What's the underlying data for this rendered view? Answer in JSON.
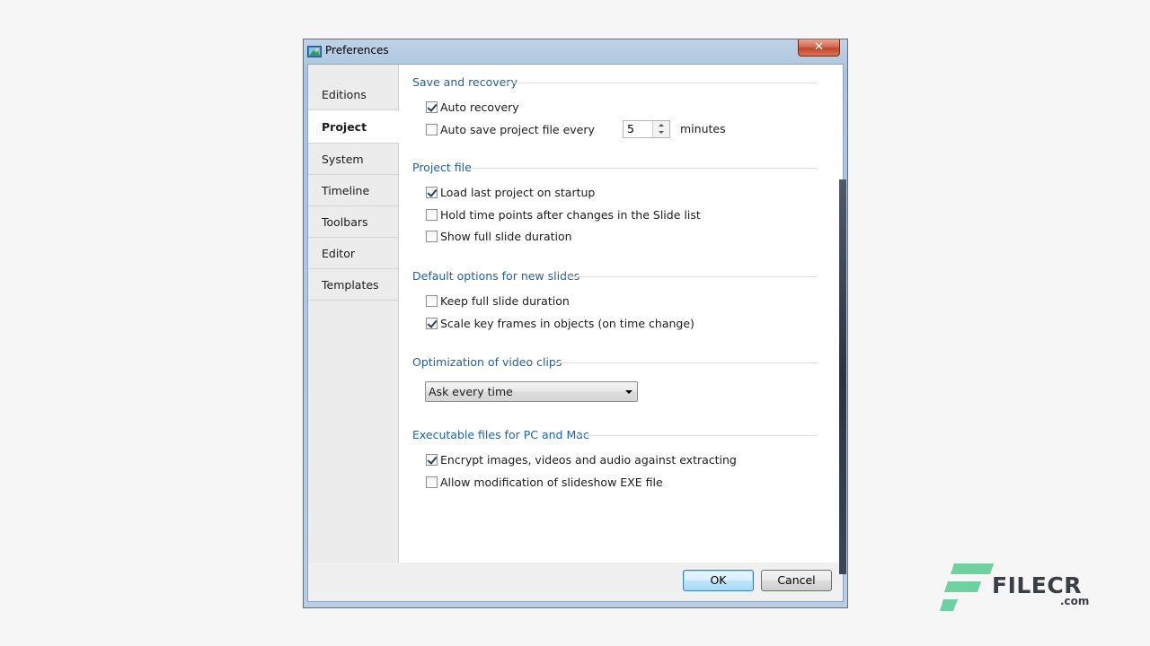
{
  "window": {
    "title": "Preferences",
    "close_glyph": "✕"
  },
  "sidebar": {
    "items": [
      {
        "label": "Editions"
      },
      {
        "label": "Project",
        "active": true
      },
      {
        "label": "System"
      },
      {
        "label": "Timeline"
      },
      {
        "label": "Toolbars"
      },
      {
        "label": "Editor"
      },
      {
        "label": "Templates"
      }
    ]
  },
  "content": {
    "save_recovery": {
      "title": "Save and recovery",
      "auto_recovery": {
        "label": "Auto recovery",
        "checked": true
      },
      "auto_save": {
        "label": "Auto save project file every",
        "checked": false
      },
      "spin_value": "5",
      "minutes_label": "minutes"
    },
    "project_file": {
      "title": "Project file",
      "load_last": {
        "label": "Load last project on startup",
        "checked": true
      },
      "hold_time": {
        "label": "Hold time points after changes in the Slide list",
        "checked": false
      },
      "show_full": {
        "label": "Show full slide duration",
        "checked": false
      }
    },
    "default_options": {
      "title": "Default options for new slides",
      "keep_full": {
        "label": "Keep full slide duration",
        "checked": false
      },
      "scale_keys": {
        "label": "Scale key frames in objects (on time change)",
        "checked": true
      }
    },
    "optimization": {
      "title": "Optimization of video clips",
      "select_value": "Ask every time"
    },
    "executables": {
      "title": "Executable files for PC and Mac",
      "encrypt": {
        "label": "Encrypt images, videos and audio against extracting",
        "checked": true
      },
      "allow_mod": {
        "label": "Allow modification of slideshow EXE file",
        "checked": false
      }
    }
  },
  "footer": {
    "ok_label": "OK",
    "cancel_label": "Cancel"
  },
  "watermark": {
    "text": "FILECR",
    "suffix": ".com"
  },
  "colors": {
    "section_title": "#1e5fa8",
    "watermark_green": "#6fd0a0",
    "close_red": "#c2452b"
  }
}
